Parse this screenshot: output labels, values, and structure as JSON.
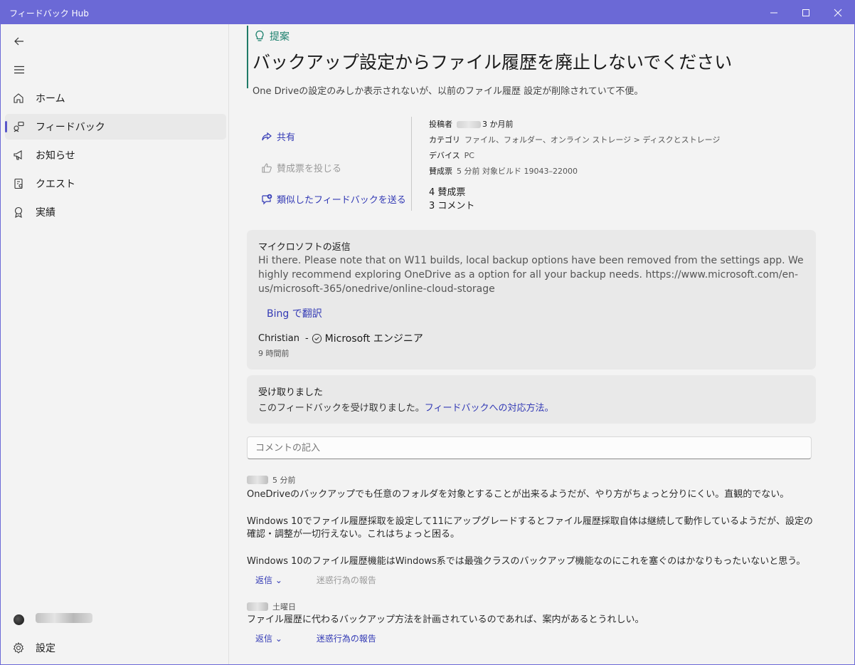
{
  "window": {
    "title": "フィードバック Hub",
    "accent": "#6b69d6"
  },
  "sidebar": {
    "items": [
      {
        "label": "ホーム",
        "icon": "home-icon"
      },
      {
        "label": "フィードバック",
        "icon": "feedback-icon",
        "selected": true
      },
      {
        "label": "お知らせ",
        "icon": "megaphone-icon"
      },
      {
        "label": "クエスト",
        "icon": "quest-icon"
      },
      {
        "label": "実績",
        "icon": "badge-icon"
      }
    ],
    "settings_label": "設定"
  },
  "post": {
    "category": "提案",
    "title": "バックアップ設定からファイル履歴を廃止しないでください",
    "description": "One Driveの設定のみしか表示されないが、以前のファイル履歴 設定が削除されていて不便。"
  },
  "actions": {
    "share": "共有",
    "upvote": "賛成票を投じる",
    "similar": "類似したフィードバックを送る"
  },
  "meta": {
    "poster_label": "投稿者",
    "poster_time": "3 か月前",
    "category_label": "カテゴリ",
    "category_value": "ファイル、フォルダー、オンライン ストレージ > ディスクとストレージ",
    "device_label": "デバイス",
    "device_value": "PC",
    "votes_label": "賛成票",
    "votes_value": "5 分前  対象ビルド 19043–22000",
    "upvote_count": "4 賛成票",
    "comment_count": "3 コメント"
  },
  "ms_reply": {
    "heading": "マイクロソフトの返信",
    "body": "Hi there. Please note that on W11 builds, local backup options have been removed from the settings app. We highly recommend exploring OneDrive as a option for all your backup needs. https://www.microsoft.com/en-us/microsoft-365/onedrive/online-cloud-storage",
    "translate": "Bing で翻訳",
    "author": "Christian",
    "separator": "-",
    "role": "Microsoft エンジニア",
    "posted": "9 時間前"
  },
  "ack": {
    "heading": "受け取りました",
    "text": "このフィードバックを受け取りました。",
    "link": "フィードバックへの対応方法。"
  },
  "comment_input": {
    "placeholder": "コメントの記入"
  },
  "comments": [
    {
      "time": "5 分前",
      "paragraphs": [
        "OneDriveのバックアップでも任意のフォルダを対象とすることが出来るようだが、やり方がちょっと分りにくい。直観的でない。",
        "Windows 10でファイル履歴採取を設定して11にアップグレードするとファイル履歴採取自体は継続して動作しているようだが、設定の確認・調整が一切行えない。これはちょっと困る。",
        "Windows 10のファイル履歴機能はWindows系では最強クラスのバックアップ機能なのにこれを塞ぐのはかなりもったいないと思う。"
      ],
      "reply": "返信",
      "report": "迷惑行為の報告"
    },
    {
      "time": "土曜日",
      "paragraphs": [
        "ファイル履歴に代わるバックアップ方法を計画されているのであれば、案内があるとうれしい。"
      ],
      "reply": "返信",
      "report": "迷惑行為の報告"
    }
  ]
}
